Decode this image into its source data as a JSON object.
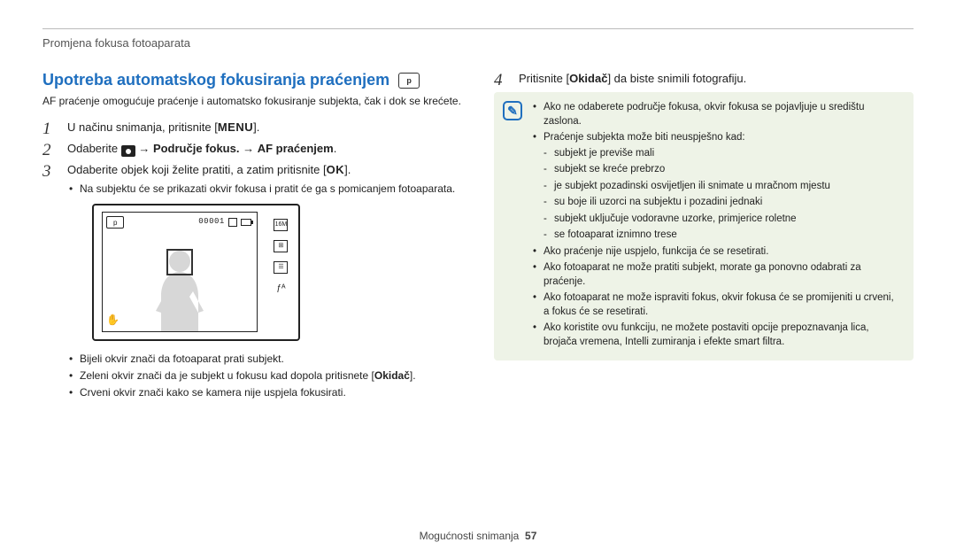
{
  "header": {
    "label": "Promjena fokusa fotoaparata"
  },
  "left": {
    "title": "Upotreba automatskog fokusiranja praćenjem",
    "mode_icon_label": "p",
    "intro": "AF praćenje omogućuje praćenje i automatsko fokusiranje subjekta, čak i dok se krećete.",
    "steps": {
      "s1_a": "U načinu snimanja, pritisnite [",
      "s1_menu": "MENU",
      "s1_b": "].",
      "s2_a": "Odaberite ",
      "s2_b": " → ",
      "s2_c": "Područje fokus.",
      "s2_d": " → ",
      "s2_e": "AF praćenjem",
      "s2_f": ".",
      "s3_a": "Odaberite objek koji želite pratiti, a zatim pritisnite [",
      "s3_ok": "OK",
      "s3_b": "].",
      "s3_sub1": "Na subjektu će se prikazati okvir fokusa i pratit će ga s pomicanjem fotoaparata."
    },
    "preview": {
      "counter": "00001",
      "mode_badge": "p",
      "right_icons": {
        "a": "16M",
        "b": "⊞",
        "c": "☰",
        "d": "ƒᴬ"
      }
    },
    "legend": {
      "l1": "Bijeli okvir znači da fotoaparat prati subjekt.",
      "l2_a": "Zeleni okvir znači da je subjekt u fokusu kad dopola pritisnete [",
      "l2_b": "Okidač",
      "l2_c": "].",
      "l3": "Crveni okvir znači kako se kamera nije uspjela fokusirati."
    }
  },
  "right": {
    "step4_a": "Pritisnite [",
    "step4_b": "Okidač",
    "step4_c": "] da biste snimili fotografiju.",
    "info": {
      "b1": "Ako ne odaberete područje fokusa, okvir fokusa se pojavljuje u središtu zaslona.",
      "b2": "Praćenje subjekta može biti neuspješno kad:",
      "b2s": {
        "a": "subjekt je previše mali",
        "b": "subjekt se kreće prebrzo",
        "c": "je subjekt pozadinski osvijetljen ili snimate u mračnom mjestu",
        "d": "su boje ili uzorci na subjektu i pozadini jednaki",
        "e": "subjekt uključuje vodoravne uzorke, primjerice roletne",
        "f": "se fotoaparat iznimno trese"
      },
      "b3": "Ako praćenje nije uspjelo, funkcija će se resetirati.",
      "b4": "Ako fotoaparat ne može pratiti subjekt, morate ga ponovno odabrati za praćenje.",
      "b5": "Ako fotoaparat ne može ispraviti fokus, okvir fokusa će se promijeniti u crveni, a fokus će se resetirati.",
      "b6": "Ako koristite ovu funkciju, ne možete postaviti opcije prepoznavanja lica, brojača vremena, Intelli zumiranja i efekte smart filtra."
    }
  },
  "footer": {
    "section": "Mogućnosti snimanja",
    "page": "57"
  }
}
